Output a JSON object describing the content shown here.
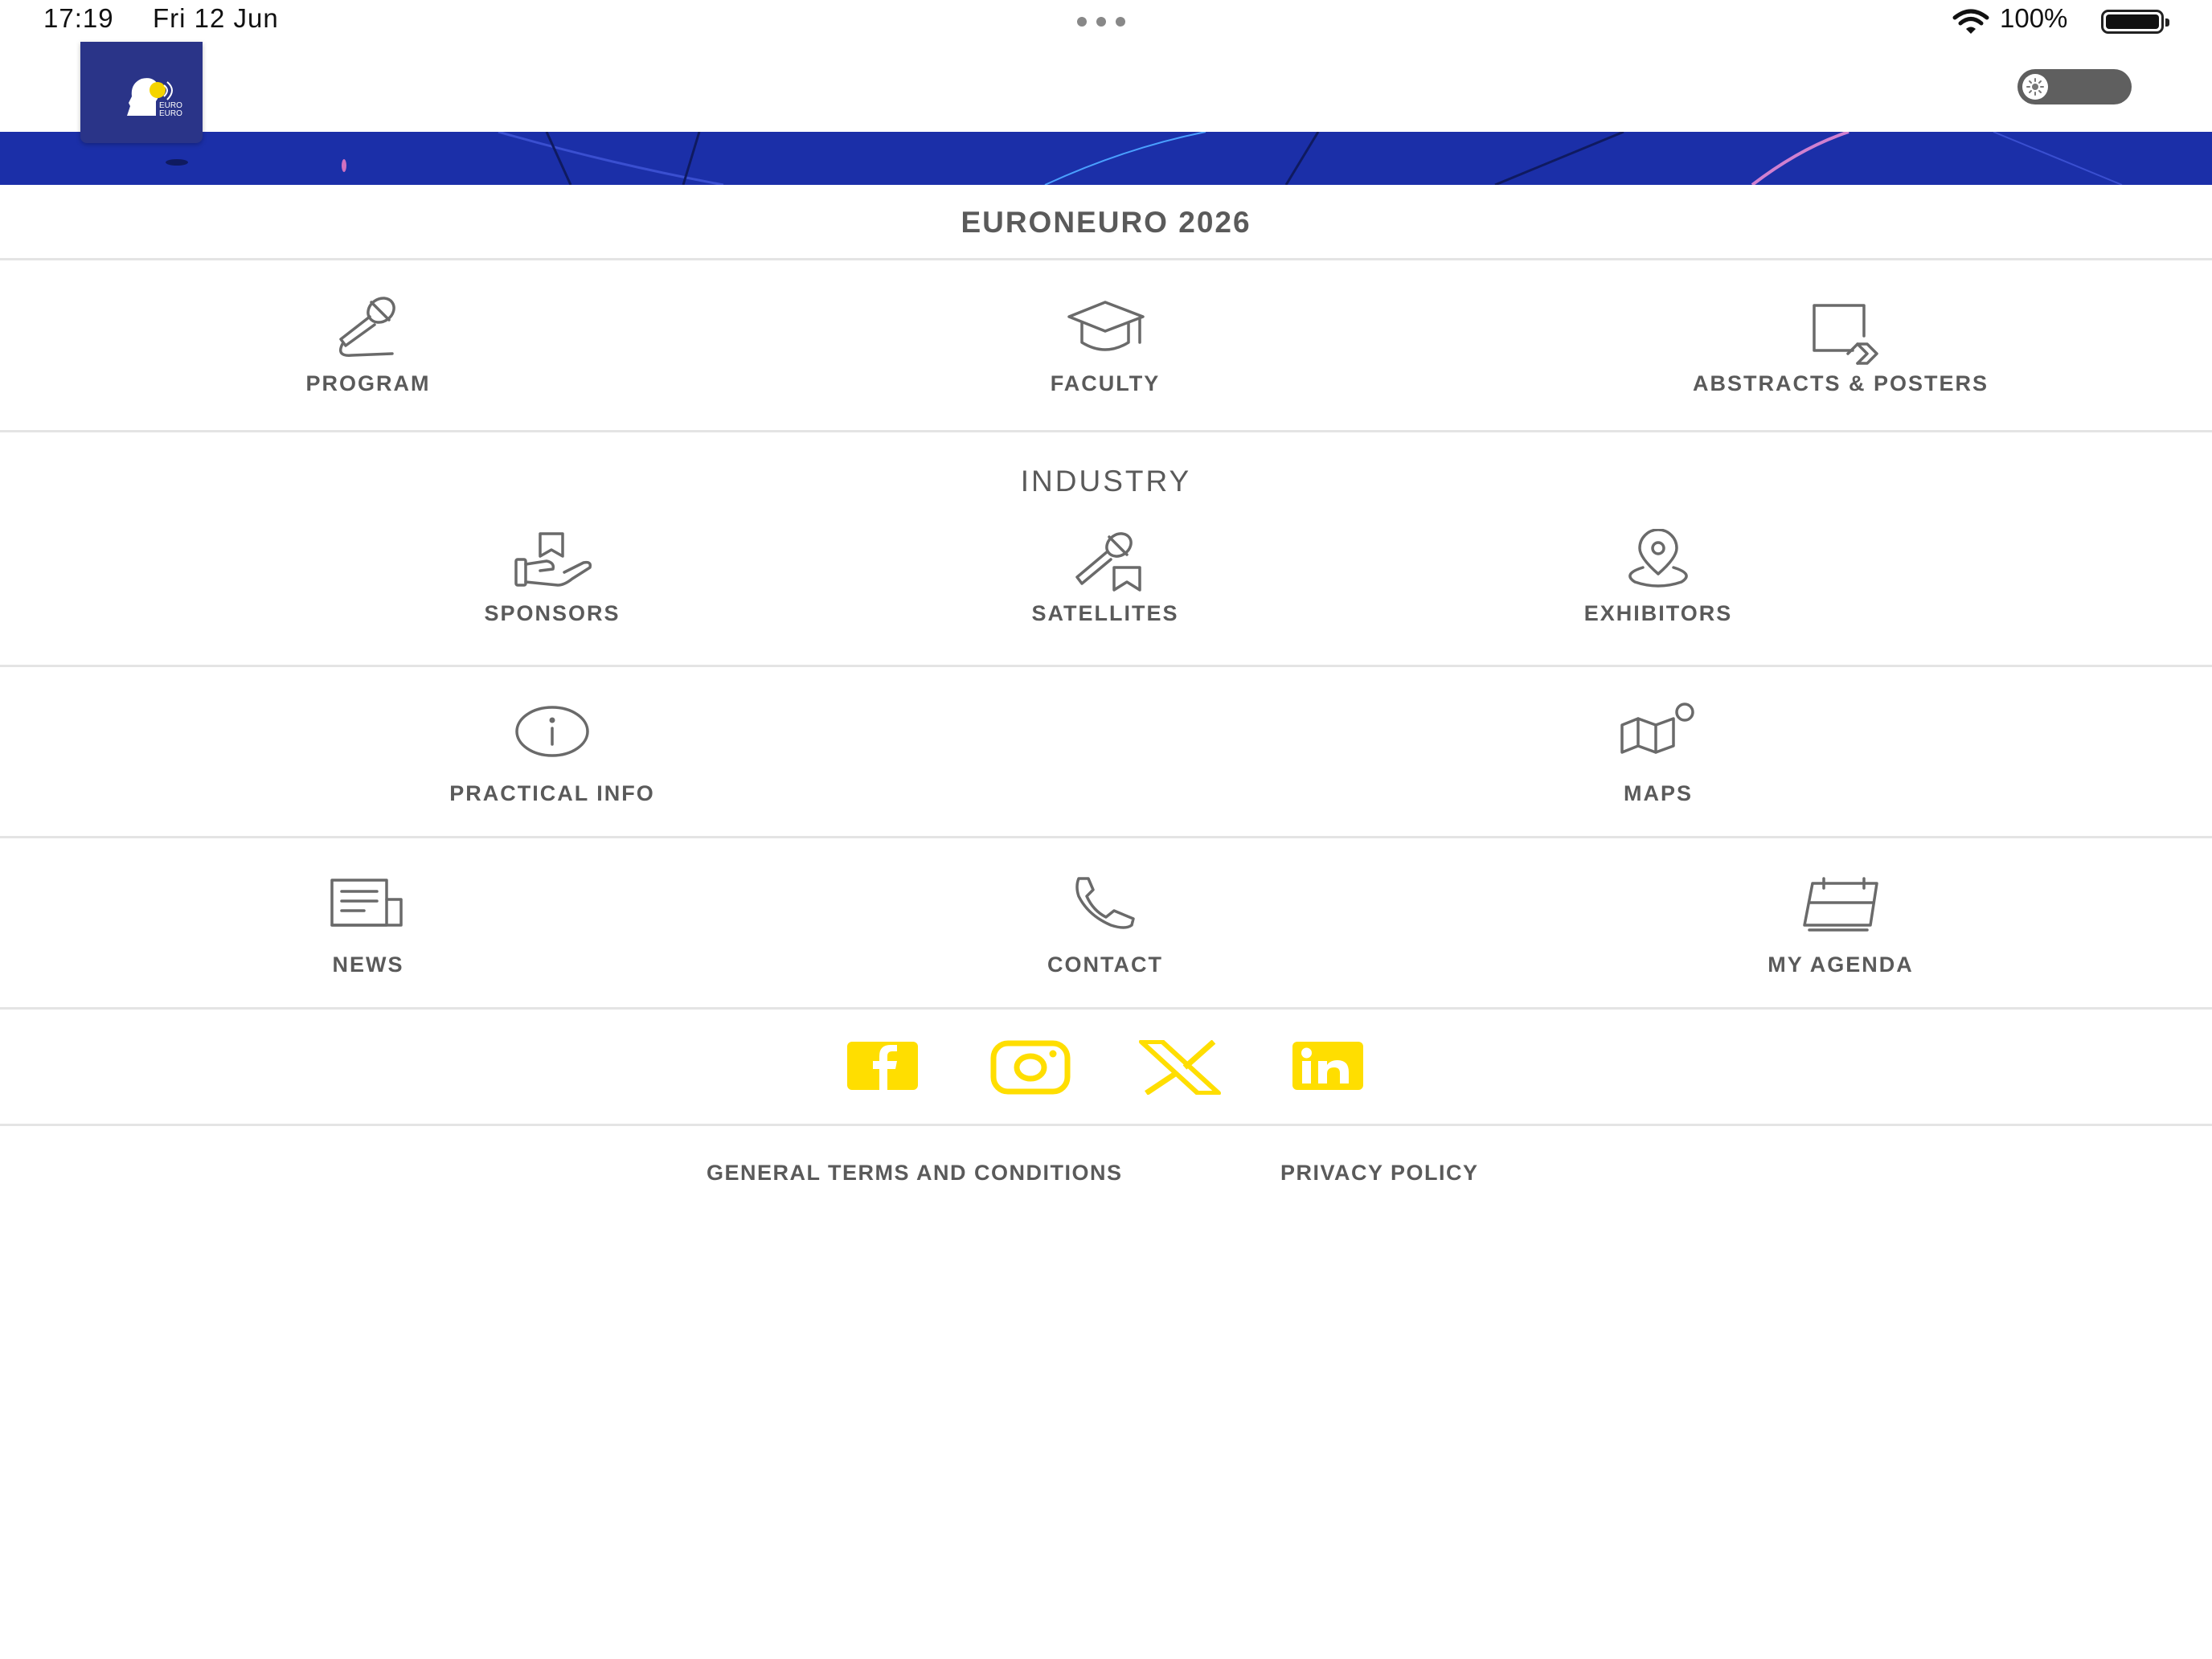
{
  "status_bar": {
    "time": "17:19",
    "date": "Fri 12 Jun",
    "battery": "100%"
  },
  "header": {
    "logo_icon": "euroneuro-logo",
    "theme_toggle_icon": "sun-icon"
  },
  "page_title": "EURONEURO 2026",
  "menu": {
    "program": "PROGRAM",
    "faculty": "FACULTY",
    "abstracts": "ABSTRACTS & POSTERS",
    "industry_title": "INDUSTRY",
    "sponsors": "SPONSORS",
    "satellites": "SATELLITES",
    "exhibitors": "EXHIBITORS",
    "practical_info": "PRACTICAL INFO",
    "maps": "MAPS",
    "news": "NEWS",
    "contact": "CONTACT",
    "my_agenda": "MY AGENDA"
  },
  "social": [
    "facebook-icon",
    "instagram-icon",
    "x-icon",
    "linkedin-icon"
  ],
  "footer": {
    "terms": "GENERAL TERMS AND CONDITIONS",
    "privacy": "PRIVACY POLICY"
  },
  "colors": {
    "brand_blue": "#1b2fa8",
    "logo_bg": "#2a3488",
    "social_yellow": "#ffde00",
    "text_gray": "#5a5a5a"
  }
}
